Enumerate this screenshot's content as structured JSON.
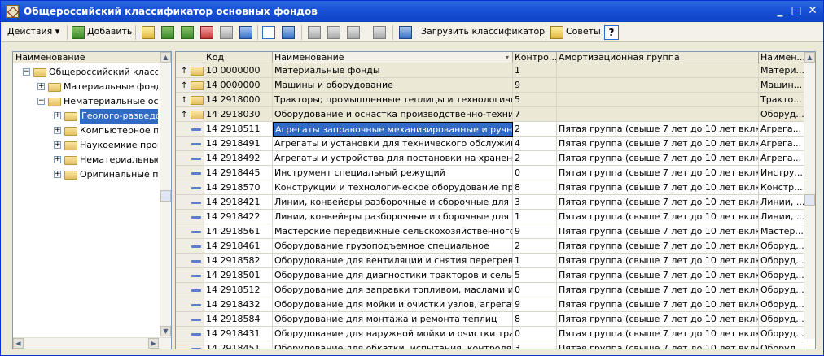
{
  "window": {
    "title": "Общероссийский классификатор основных фондов",
    "minimize": "_",
    "maximize": "□",
    "close": "✕"
  },
  "toolbar": {
    "actions_label": "Действия ▾",
    "add_label": "Добавить",
    "load_label": "Загрузить классификатор",
    "tips_label": "Советы",
    "help_label": "?"
  },
  "tree": {
    "header": "Наименование",
    "items": [
      {
        "label": "Общероссийский классиф",
        "expander": "−"
      },
      {
        "label": "Материальные фонды",
        "expander": "+"
      },
      {
        "label": "Нематериальные основные",
        "expander": "−"
      },
      {
        "label": "Геолого-разведочные",
        "expander": "+"
      },
      {
        "label": "Компьютерное программное",
        "expander": "+"
      },
      {
        "label": "Наукоемкие промышленные",
        "expander": "+"
      },
      {
        "label": "Нематериальные",
        "expander": "+"
      },
      {
        "label": "Оригинальные произведения",
        "expander": "+"
      }
    ]
  },
  "grid": {
    "headers": {
      "code": "Код",
      "name": "Наименование",
      "control": "Контро...",
      "group": "Амортизационная группа",
      "name2": "Наимен..."
    },
    "sort_arrow": "▾",
    "rows": [
      {
        "type": "group",
        "code": "10 0000000",
        "name": "Материальные фонды",
        "control": "1",
        "group": "",
        "name2": "Матери..."
      },
      {
        "type": "group",
        "code": "14 0000000",
        "name": "Машины и оборудование",
        "control": "9",
        "group": "",
        "name2": "Машин..."
      },
      {
        "type": "group",
        "code": "14 2918000",
        "name": "Тракторы; промышленные теплицы и технологичес...",
        "control": "5",
        "group": "",
        "name2": "Тракто..."
      },
      {
        "type": "group",
        "code": "14 2918030",
        "name": "Оборудование и оснастка производственно-технич...",
        "control": "7",
        "group": "",
        "name2": "Оборуд..."
      },
      {
        "type": "item",
        "code": "14 2918511",
        "name": "Агрегаты заправочные механизированные и ручные",
        "control": "2",
        "group": "Пятая группа (свыше 7 лет до 10 лет включ...",
        "name2": "Агрега..."
      },
      {
        "type": "item",
        "code": "14 2918491",
        "name": "Агрегаты и установки для технического обслужива...",
        "control": "4",
        "group": "Пятая группа (свыше 7 лет до 10 лет включ...",
        "name2": "Агрега..."
      },
      {
        "type": "item",
        "code": "14 2918492",
        "name": "Агрегаты и устройства для постановки на хранение...",
        "control": "2",
        "group": "Пятая группа (свыше 7 лет до 10 лет включ...",
        "name2": "Агрега..."
      },
      {
        "type": "item",
        "code": "14 2918445",
        "name": "Инструмент специальный режущий",
        "control": "0",
        "group": "Пятая группа (свыше 7 лет до 10 лет включ...",
        "name2": "Инстру..."
      },
      {
        "type": "item",
        "code": "14 2918570",
        "name": "Конструкции и технологическое оборудование про...",
        "control": "8",
        "group": "Пятая группа (свыше 7 лет до 10 лет включ...",
        "name2": "Констр..."
      },
      {
        "type": "item",
        "code": "14 2918421",
        "name": "Линии, конвейеры разборочные и сборочные для т...",
        "control": "3",
        "group": "Пятая группа (свыше 7 лет до 10 лет включ...",
        "name2": "Линии, ..."
      },
      {
        "type": "item",
        "code": "14 2918422",
        "name": "Линии, конвейеры разборочные и сборочные для у...",
        "control": "1",
        "group": "Пятая группа (свыше 7 лет до 10 лет включ...",
        "name2": "Линии, ..."
      },
      {
        "type": "item",
        "code": "14 2918561",
        "name": "Мастерские передвижные сельскохозяйственного ...",
        "control": "9",
        "group": "Пятая группа (свыше 7 лет до 10 лет включ...",
        "name2": "Мастер..."
      },
      {
        "type": "item",
        "code": "14 2918461",
        "name": "Оборудование грузоподъемное специальное",
        "control": "2",
        "group": "Пятая группа (свыше 7 лет до 10 лет включ...",
        "name2": "Оборуд..."
      },
      {
        "type": "item",
        "code": "14 2918582",
        "name": "Оборудование для вентиляции и снятия перегрева ...",
        "control": "1",
        "group": "Пятая группа (свыше 7 лет до 10 лет включ...",
        "name2": "Оборуд..."
      },
      {
        "type": "item",
        "code": "14 2918501",
        "name": "Оборудование для диагностики тракторов и сельск...",
        "control": "5",
        "group": "Пятая группа (свыше 7 лет до 10 лет включ...",
        "name2": "Оборуд..."
      },
      {
        "type": "item",
        "code": "14 2918512",
        "name": "Оборудование для заправки топливом, маслами и ...",
        "control": "0",
        "group": "Пятая группа (свыше 7 лет до 10 лет включ...",
        "name2": "Оборуд..."
      },
      {
        "type": "item",
        "code": "14 2918432",
        "name": "Оборудование для мойки и очистки узлов, агрегато...",
        "control": "9",
        "group": "Пятая группа (свыше 7 лет до 10 лет включ...",
        "name2": "Оборуд..."
      },
      {
        "type": "item",
        "code": "14 2918584",
        "name": "Оборудование для монтажа и ремонта теплиц",
        "control": "8",
        "group": "Пятая группа (свыше 7 лет до 10 лет включ...",
        "name2": "Оборуд..."
      },
      {
        "type": "item",
        "code": "14 2918431",
        "name": "Оборудование для наружной мойки и очистки тракт...",
        "control": "0",
        "group": "Пятая группа (свыше 7 лет до 10 лет включ...",
        "name2": "Оборуд..."
      },
      {
        "type": "item",
        "code": "14 2918451",
        "name": "Оборудование для обкатки, испытания, контроля и ...",
        "control": "3",
        "group": "Пятая группа (свыше 7 лет до 10 лет включ...",
        "name2": "Оборуд..."
      }
    ]
  }
}
